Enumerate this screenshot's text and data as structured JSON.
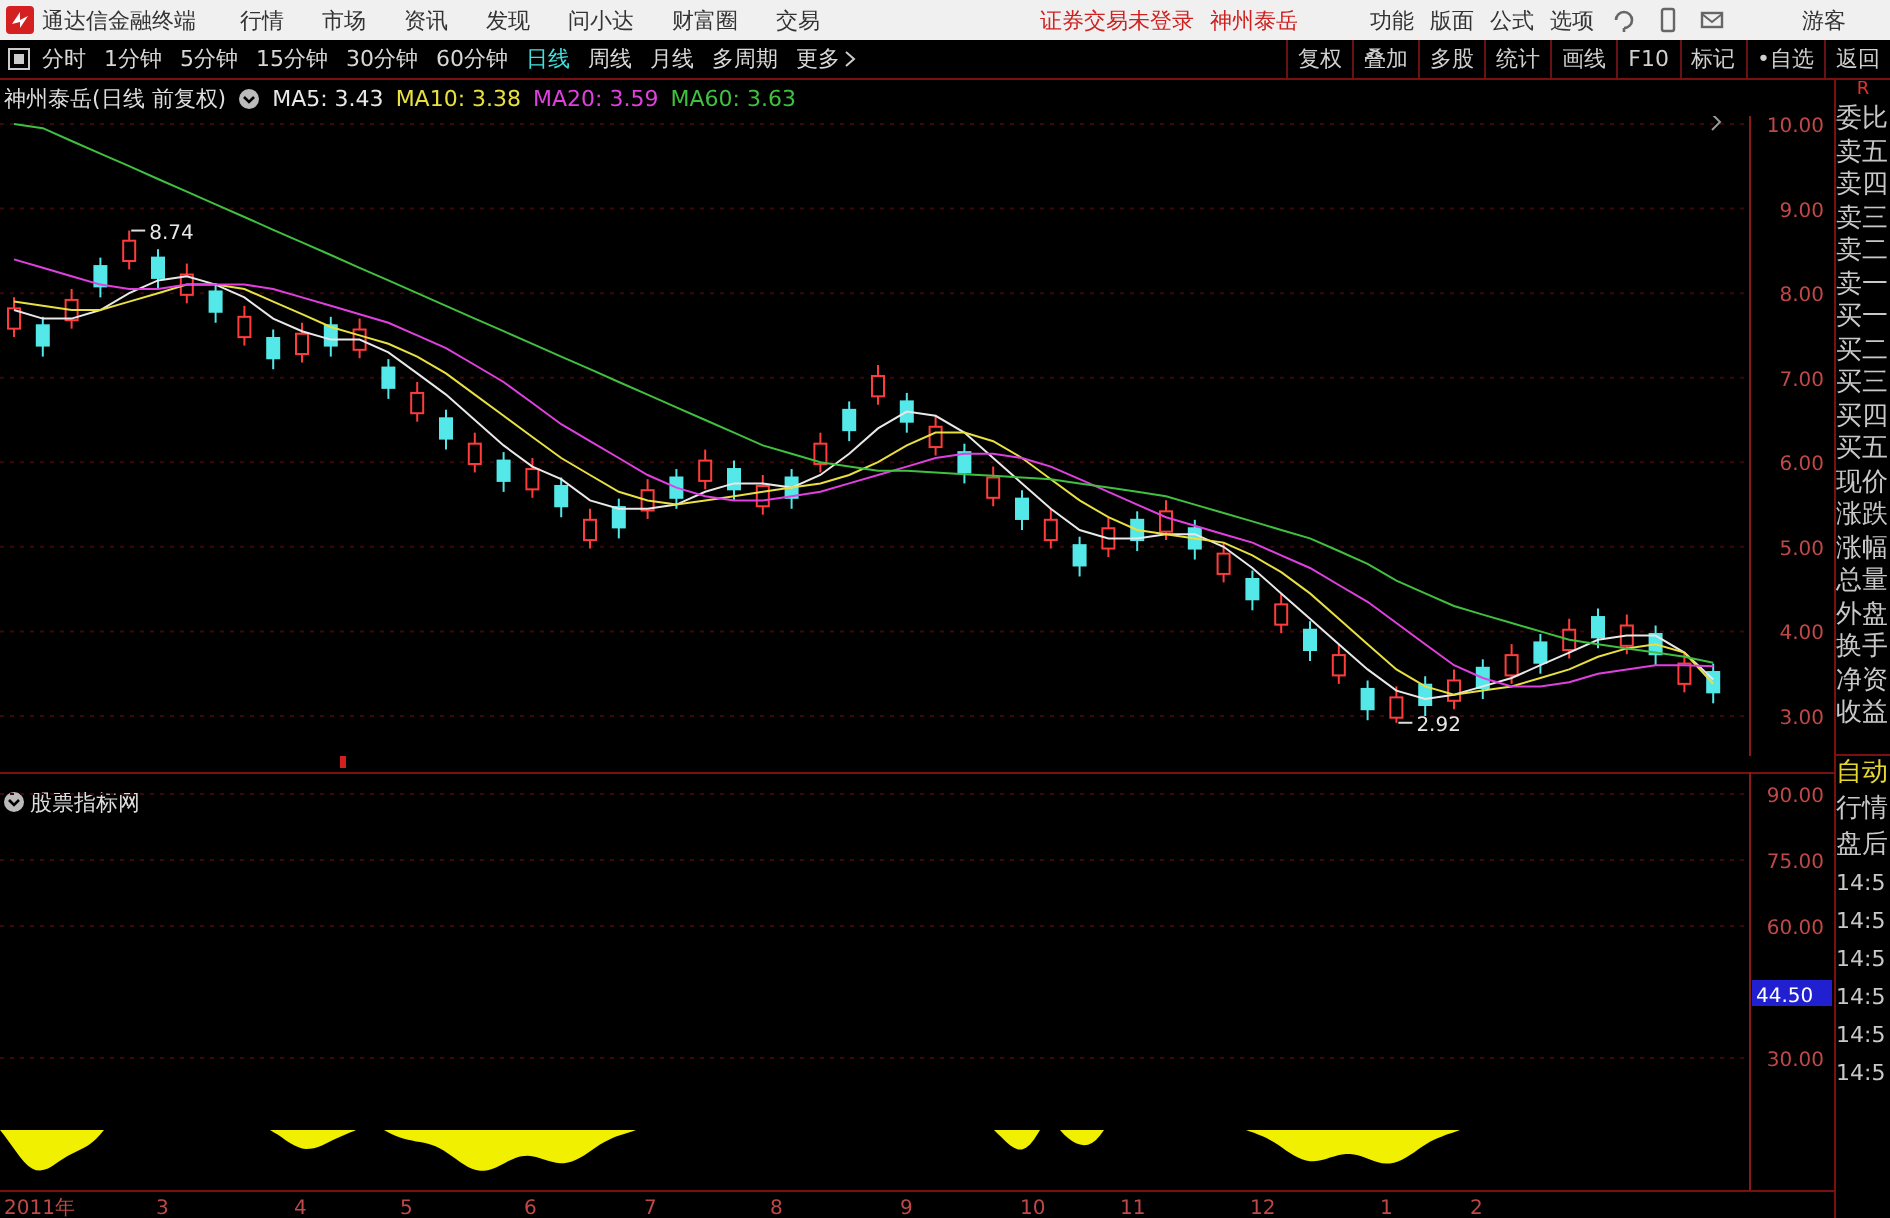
{
  "app_title": "通达信金融终端",
  "menu": [
    "行情",
    "市场",
    "资讯",
    "发现",
    "问小达",
    "财富圈",
    "交易"
  ],
  "login_notice": "证券交易未登录",
  "stock_link": "神州泰岳",
  "top_actions": [
    "功能",
    "版面",
    "公式",
    "选项"
  ],
  "user": "游客",
  "periods": [
    {
      "label": "分时",
      "selected": false
    },
    {
      "label": "1分钟",
      "selected": false
    },
    {
      "label": "5分钟",
      "selected": false
    },
    {
      "label": "15分钟",
      "selected": false
    },
    {
      "label": "30分钟",
      "selected": false
    },
    {
      "label": "60分钟",
      "selected": false
    },
    {
      "label": "日线",
      "selected": true
    },
    {
      "label": "周线",
      "selected": false
    },
    {
      "label": "月线",
      "selected": false
    },
    {
      "label": "多周期",
      "selected": false
    }
  ],
  "more": "更多",
  "tools": [
    "复权",
    "叠加",
    "多股",
    "统计",
    "画线",
    "F10",
    "标记",
    "•自选",
    "返回"
  ],
  "corner_label": "R",
  "chart": {
    "title": "神州泰岳(日线 前复权)",
    "chart_data": {
      "type": "candlestick",
      "grid": true,
      "ylim": [
        3,
        10
      ],
      "yticks": [
        {
          "value": 10,
          "label": "10.00"
        },
        {
          "value": 9,
          "label": "9.00"
        },
        {
          "value": 8,
          "label": "8.00"
        },
        {
          "value": 7,
          "label": "7.00"
        },
        {
          "value": 6,
          "label": "6.00"
        },
        {
          "value": 5,
          "label": "5.00"
        },
        {
          "value": 4,
          "label": "4.00"
        },
        {
          "value": 3,
          "label": "3.00"
        }
      ],
      "ohlc": [
        [
          7.58,
          7.95,
          7.48,
          7.82
        ],
        [
          7.62,
          7.72,
          7.25,
          7.38
        ],
        [
          7.68,
          8.05,
          7.58,
          7.92
        ],
        [
          8.32,
          8.42,
          7.95,
          8.08
        ],
        [
          8.38,
          8.74,
          8.28,
          8.62
        ],
        [
          8.42,
          8.52,
          8.05,
          8.18
        ],
        [
          7.98,
          8.35,
          7.88,
          8.22
        ],
        [
          8.02,
          8.12,
          7.65,
          7.78
        ],
        [
          7.48,
          7.85,
          7.38,
          7.72
        ],
        [
          7.47,
          7.57,
          7.1,
          7.23
        ],
        [
          7.28,
          7.65,
          7.18,
          7.52
        ],
        [
          7.62,
          7.72,
          7.25,
          7.38
        ],
        [
          7.33,
          7.7,
          7.23,
          7.57
        ],
        [
          7.12,
          7.22,
          6.75,
          6.88
        ],
        [
          6.58,
          6.95,
          6.48,
          6.82
        ],
        [
          6.52,
          6.62,
          6.15,
          6.28
        ],
        [
          5.98,
          6.35,
          5.88,
          6.22
        ],
        [
          6.02,
          6.12,
          5.65,
          5.78
        ],
        [
          5.68,
          6.05,
          5.58,
          5.92
        ],
        [
          5.72,
          5.82,
          5.35,
          5.48
        ],
        [
          5.08,
          5.45,
          4.98,
          5.32
        ],
        [
          5.47,
          5.57,
          5.1,
          5.23
        ],
        [
          5.43,
          5.8,
          5.33,
          5.67
        ],
        [
          5.82,
          5.92,
          5.45,
          5.58
        ],
        [
          5.78,
          6.15,
          5.68,
          6.02
        ],
        [
          5.92,
          6.02,
          5.55,
          5.68
        ],
        [
          5.48,
          5.85,
          5.38,
          5.72
        ],
        [
          5.82,
          5.92,
          5.45,
          5.58
        ],
        [
          5.98,
          6.35,
          5.88,
          6.22
        ],
        [
          6.62,
          6.72,
          6.25,
          6.38
        ],
        [
          6.78,
          7.15,
          6.68,
          7.02
        ],
        [
          6.72,
          6.82,
          6.35,
          6.48
        ],
        [
          6.18,
          6.55,
          6.08,
          6.42
        ],
        [
          6.12,
          6.22,
          5.75,
          5.88
        ],
        [
          5.58,
          5.95,
          5.48,
          5.82
        ],
        [
          5.57,
          5.67,
          5.2,
          5.33
        ],
        [
          5.08,
          5.45,
          4.98,
          5.32
        ],
        [
          5.02,
          5.12,
          4.65,
          4.78
        ],
        [
          4.98,
          5.35,
          4.88,
          5.22
        ],
        [
          5.32,
          5.42,
          4.95,
          5.08
        ],
        [
          5.18,
          5.55,
          5.08,
          5.42
        ],
        [
          5.22,
          5.32,
          4.85,
          4.98
        ],
        [
          4.68,
          5.05,
          4.58,
          4.92
        ],
        [
          4.62,
          4.72,
          4.25,
          4.38
        ],
        [
          4.08,
          4.45,
          3.98,
          4.32
        ],
        [
          4.02,
          4.12,
          3.65,
          3.78
        ],
        [
          3.48,
          3.85,
          3.38,
          3.72
        ],
        [
          3.32,
          3.42,
          2.95,
          3.08
        ],
        [
          2.98,
          3.35,
          2.92,
          3.22
        ],
        [
          3.37,
          3.47,
          3.0,
          3.13
        ],
        [
          3.18,
          3.55,
          3.08,
          3.42
        ],
        [
          3.57,
          3.67,
          3.2,
          3.33
        ],
        [
          3.48,
          3.85,
          3.38,
          3.72
        ],
        [
          3.87,
          3.97,
          3.5,
          3.63
        ],
        [
          3.78,
          4.15,
          3.68,
          4.02
        ],
        [
          4.17,
          4.27,
          3.8,
          3.93
        ],
        [
          3.83,
          4.2,
          3.73,
          4.07
        ],
        [
          3.97,
          4.07,
          3.6,
          3.73
        ],
        [
          3.38,
          3.75,
          3.28,
          3.62
        ],
        [
          3.52,
          3.62,
          3.15,
          3.28
        ]
      ],
      "series": [
        {
          "name": "MA5: 3.43",
          "type": "line",
          "color": "#e8e8e8",
          "values": [
            7.8,
            7.7,
            7.7,
            7.8,
            8.0,
            8.15,
            8.2,
            8.1,
            7.95,
            7.7,
            7.55,
            7.45,
            7.45,
            7.3,
            7.05,
            6.8,
            6.5,
            6.2,
            5.95,
            5.8,
            5.55,
            5.45,
            5.45,
            5.5,
            5.65,
            5.75,
            5.75,
            5.7,
            5.85,
            6.1,
            6.4,
            6.6,
            6.55,
            6.35,
            6.05,
            5.75,
            5.45,
            5.2,
            5.1,
            5.1,
            5.15,
            5.15,
            5.0,
            4.75,
            4.45,
            4.15,
            3.85,
            3.55,
            3.3,
            3.2,
            3.25,
            3.35,
            3.45,
            3.6,
            3.75,
            3.9,
            3.95,
            3.95,
            3.75,
            3.43
          ]
        },
        {
          "name": "MA10: 3.38",
          "type": "line",
          "color": "#e8e040",
          "values": [
            7.9,
            7.85,
            7.8,
            7.8,
            7.9,
            8.0,
            8.1,
            8.1,
            8.05,
            7.9,
            7.75,
            7.6,
            7.5,
            7.4,
            7.25,
            7.05,
            6.8,
            6.55,
            6.3,
            6.05,
            5.85,
            5.65,
            5.55,
            5.5,
            5.55,
            5.6,
            5.65,
            5.7,
            5.75,
            5.85,
            6.0,
            6.2,
            6.35,
            6.35,
            6.25,
            6.05,
            5.8,
            5.55,
            5.35,
            5.2,
            5.15,
            5.1,
            5.05,
            4.9,
            4.7,
            4.45,
            4.15,
            3.85,
            3.55,
            3.35,
            3.25,
            3.3,
            3.35,
            3.45,
            3.55,
            3.7,
            3.8,
            3.85,
            3.75,
            3.38
          ]
        },
        {
          "name": "MA20: 3.59",
          "type": "line",
          "color": "#e040e0",
          "values": [
            8.4,
            8.3,
            8.2,
            8.1,
            8.05,
            8.05,
            8.1,
            8.1,
            8.1,
            8.05,
            7.95,
            7.85,
            7.75,
            7.65,
            7.5,
            7.35,
            7.15,
            6.95,
            6.7,
            6.45,
            6.25,
            6.05,
            5.85,
            5.7,
            5.6,
            5.55,
            5.55,
            5.6,
            5.65,
            5.75,
            5.85,
            5.95,
            6.05,
            6.1,
            6.1,
            6.05,
            5.95,
            5.8,
            5.65,
            5.5,
            5.35,
            5.25,
            5.15,
            5.05,
            4.9,
            4.75,
            4.55,
            4.35,
            4.1,
            3.85,
            3.6,
            3.45,
            3.35,
            3.35,
            3.4,
            3.5,
            3.55,
            3.6,
            3.6,
            3.59
          ]
        },
        {
          "name": "MA60: 3.63",
          "type": "line",
          "color": "#40c040",
          "values": [
            10.0,
            9.95,
            9.8,
            9.65,
            9.5,
            9.35,
            9.2,
            9.05,
            8.9,
            8.75,
            8.6,
            8.45,
            8.3,
            8.15,
            8.0,
            7.85,
            7.7,
            7.55,
            7.4,
            7.25,
            7.1,
            6.95,
            6.8,
            6.65,
            6.5,
            6.35,
            6.2,
            6.1,
            6.0,
            5.95,
            5.9,
            5.9,
            5.88,
            5.86,
            5.84,
            5.82,
            5.8,
            5.75,
            5.7,
            5.65,
            5.6,
            5.5,
            5.4,
            5.3,
            5.2,
            5.1,
            4.95,
            4.8,
            4.6,
            4.45,
            4.3,
            4.2,
            4.1,
            4.0,
            3.9,
            3.85,
            3.8,
            3.75,
            3.7,
            3.63
          ]
        }
      ],
      "annotations": [
        "8.74",
        "2.92"
      ]
    }
  },
  "date_axis": [
    "2011年",
    "3",
    "4",
    "5",
    "6",
    "7",
    "8",
    "9",
    "10",
    "11",
    "12",
    "1",
    "2"
  ],
  "indicator_panel": {
    "title": "股票指标网",
    "ticks": [
      "90.00",
      "75.00",
      "60.00",
      "30.00"
    ],
    "current_value": "44.50"
  },
  "quote_fields": [
    "委比",
    "卖五",
    "卖四",
    "卖三",
    "卖二",
    "卖一",
    "买一",
    "买二",
    "买三",
    "买四",
    "买五",
    "现价",
    "涨跌",
    "涨幅",
    "总量",
    "外盘",
    "换手",
    "净资",
    "收益"
  ],
  "panel_tabs": [
    {
      "label": "自动",
      "selected": true
    },
    {
      "label": "行情",
      "selected": false
    },
    {
      "label": "盘后",
      "selected": false
    }
  ],
  "trades": [
    "14:5",
    "14:5",
    "14:5",
    "14:5",
    "14:5",
    "14:5"
  ]
}
